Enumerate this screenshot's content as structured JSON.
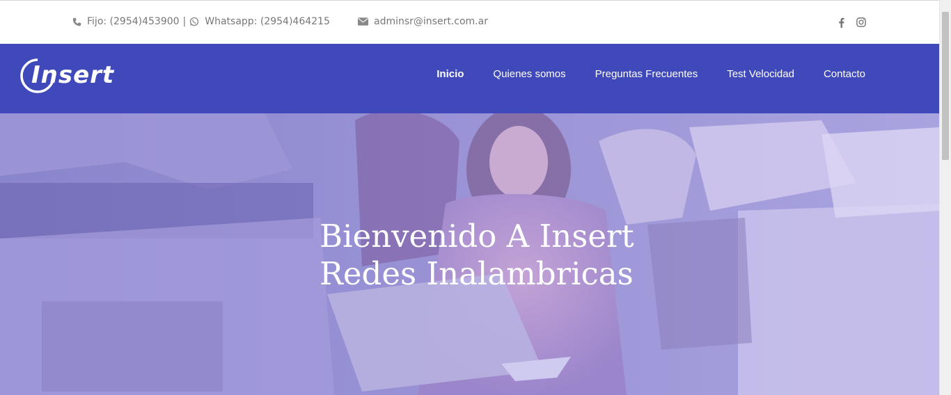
{
  "topbar": {
    "phone_text": "Fijo: (2954)453900",
    "separator": "|",
    "whatsapp_text": "Whatsapp: (2954)464215",
    "email_text": "adminsr@insert.com.ar",
    "social_icons": [
      "facebook-icon",
      "instagram-icon"
    ]
  },
  "brand": {
    "logo_text": "Insert",
    "nav_color": "#4049b9"
  },
  "nav": {
    "items": [
      {
        "label": "Inicio",
        "active": true
      },
      {
        "label": "Quienes somos"
      },
      {
        "label": "Preguntas Frecuentes"
      },
      {
        "label": "Test Velocidad"
      },
      {
        "label": "Contacto"
      }
    ]
  },
  "hero": {
    "title_line1": "Bienvenido A Insert",
    "title_line2": "Redes Inalambricas",
    "overlay_color": "#7f7ed6"
  }
}
